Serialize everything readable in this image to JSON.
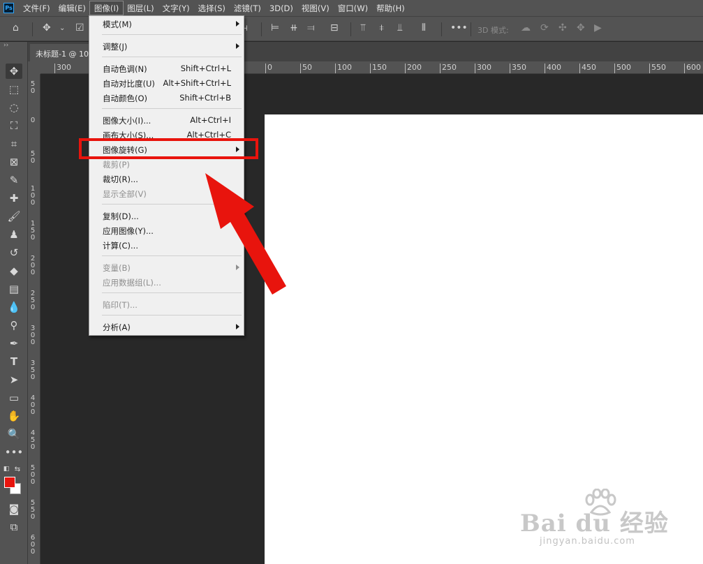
{
  "app": {
    "logo": "Ps",
    "logo_color": "#31a8ff"
  },
  "menubar": {
    "items": [
      {
        "label": "文件(F)"
      },
      {
        "label": "编辑(E)"
      },
      {
        "label": "图像(I)"
      },
      {
        "label": "图层(L)"
      },
      {
        "label": "文字(Y)"
      },
      {
        "label": "选择(S)"
      },
      {
        "label": "滤镜(T)"
      },
      {
        "label": "3D(D)"
      },
      {
        "label": "视图(V)"
      },
      {
        "label": "窗口(W)"
      },
      {
        "label": "帮助(H)"
      }
    ],
    "active_index": 2
  },
  "optionsbar": {
    "mode_label": "3D 模式:"
  },
  "document": {
    "tab_title": "未标题-1 @ 10"
  },
  "rulers": {
    "horizontal": [
      "300",
      "0",
      "50",
      "100",
      "150",
      "200",
      "250",
      "300",
      "350",
      "400",
      "450",
      "500",
      "550",
      "600"
    ],
    "vertical": [
      "5 0",
      "0",
      "5 0",
      "1 0 0",
      "1 5 0",
      "2 0 0",
      "2 5 0",
      "3 0 0",
      "3 5 0",
      "4 0 0",
      "4 5 0",
      "5 0 0",
      "5 5 0",
      "6 0 0"
    ]
  },
  "image_menu": {
    "items": [
      {
        "label": "模式(M)",
        "shortcut": "",
        "submenu": true,
        "disabled": false
      },
      {
        "label": "调整(J)",
        "shortcut": "",
        "submenu": true,
        "disabled": false
      },
      {
        "label": "自动色调(N)",
        "shortcut": "Shift+Ctrl+L",
        "submenu": false,
        "disabled": false
      },
      {
        "label": "自动对比度(U)",
        "shortcut": "Alt+Shift+Ctrl+L",
        "submenu": false,
        "disabled": false
      },
      {
        "label": "自动颜色(O)",
        "shortcut": "Shift+Ctrl+B",
        "submenu": false,
        "disabled": false
      },
      {
        "label": "图像大小(I)...",
        "shortcut": "Alt+Ctrl+I",
        "submenu": false,
        "disabled": false
      },
      {
        "label": "画布大小(S)...",
        "shortcut": "Alt+Ctrl+C",
        "submenu": false,
        "disabled": false
      },
      {
        "label": "图像旋转(G)",
        "shortcut": "",
        "submenu": true,
        "disabled": false
      },
      {
        "label": "裁剪(P)",
        "shortcut": "",
        "submenu": false,
        "disabled": true
      },
      {
        "label": "裁切(R)...",
        "shortcut": "",
        "submenu": false,
        "disabled": false
      },
      {
        "label": "显示全部(V)",
        "shortcut": "",
        "submenu": false,
        "disabled": true
      },
      {
        "label": "复制(D)...",
        "shortcut": "",
        "submenu": false,
        "disabled": false
      },
      {
        "label": "应用图像(Y)...",
        "shortcut": "",
        "submenu": false,
        "disabled": false
      },
      {
        "label": "计算(C)...",
        "shortcut": "",
        "submenu": false,
        "disabled": false
      },
      {
        "label": "变量(B)",
        "shortcut": "",
        "submenu": true,
        "disabled": true
      },
      {
        "label": "应用数据组(L)...",
        "shortcut": "",
        "submenu": false,
        "disabled": true
      },
      {
        "label": "陷印(T)...",
        "shortcut": "",
        "submenu": false,
        "disabled": true
      },
      {
        "label": "分析(A)",
        "shortcut": "",
        "submenu": true,
        "disabled": false
      }
    ],
    "highlighted_label": "图像旋转(G)"
  },
  "colors": {
    "foreground": "#e8140d",
    "background": "#ffffff",
    "annotation": "#e8140d"
  },
  "watermark": {
    "brand": "Bai du 经验",
    "url": "jingyan.baidu.com"
  }
}
